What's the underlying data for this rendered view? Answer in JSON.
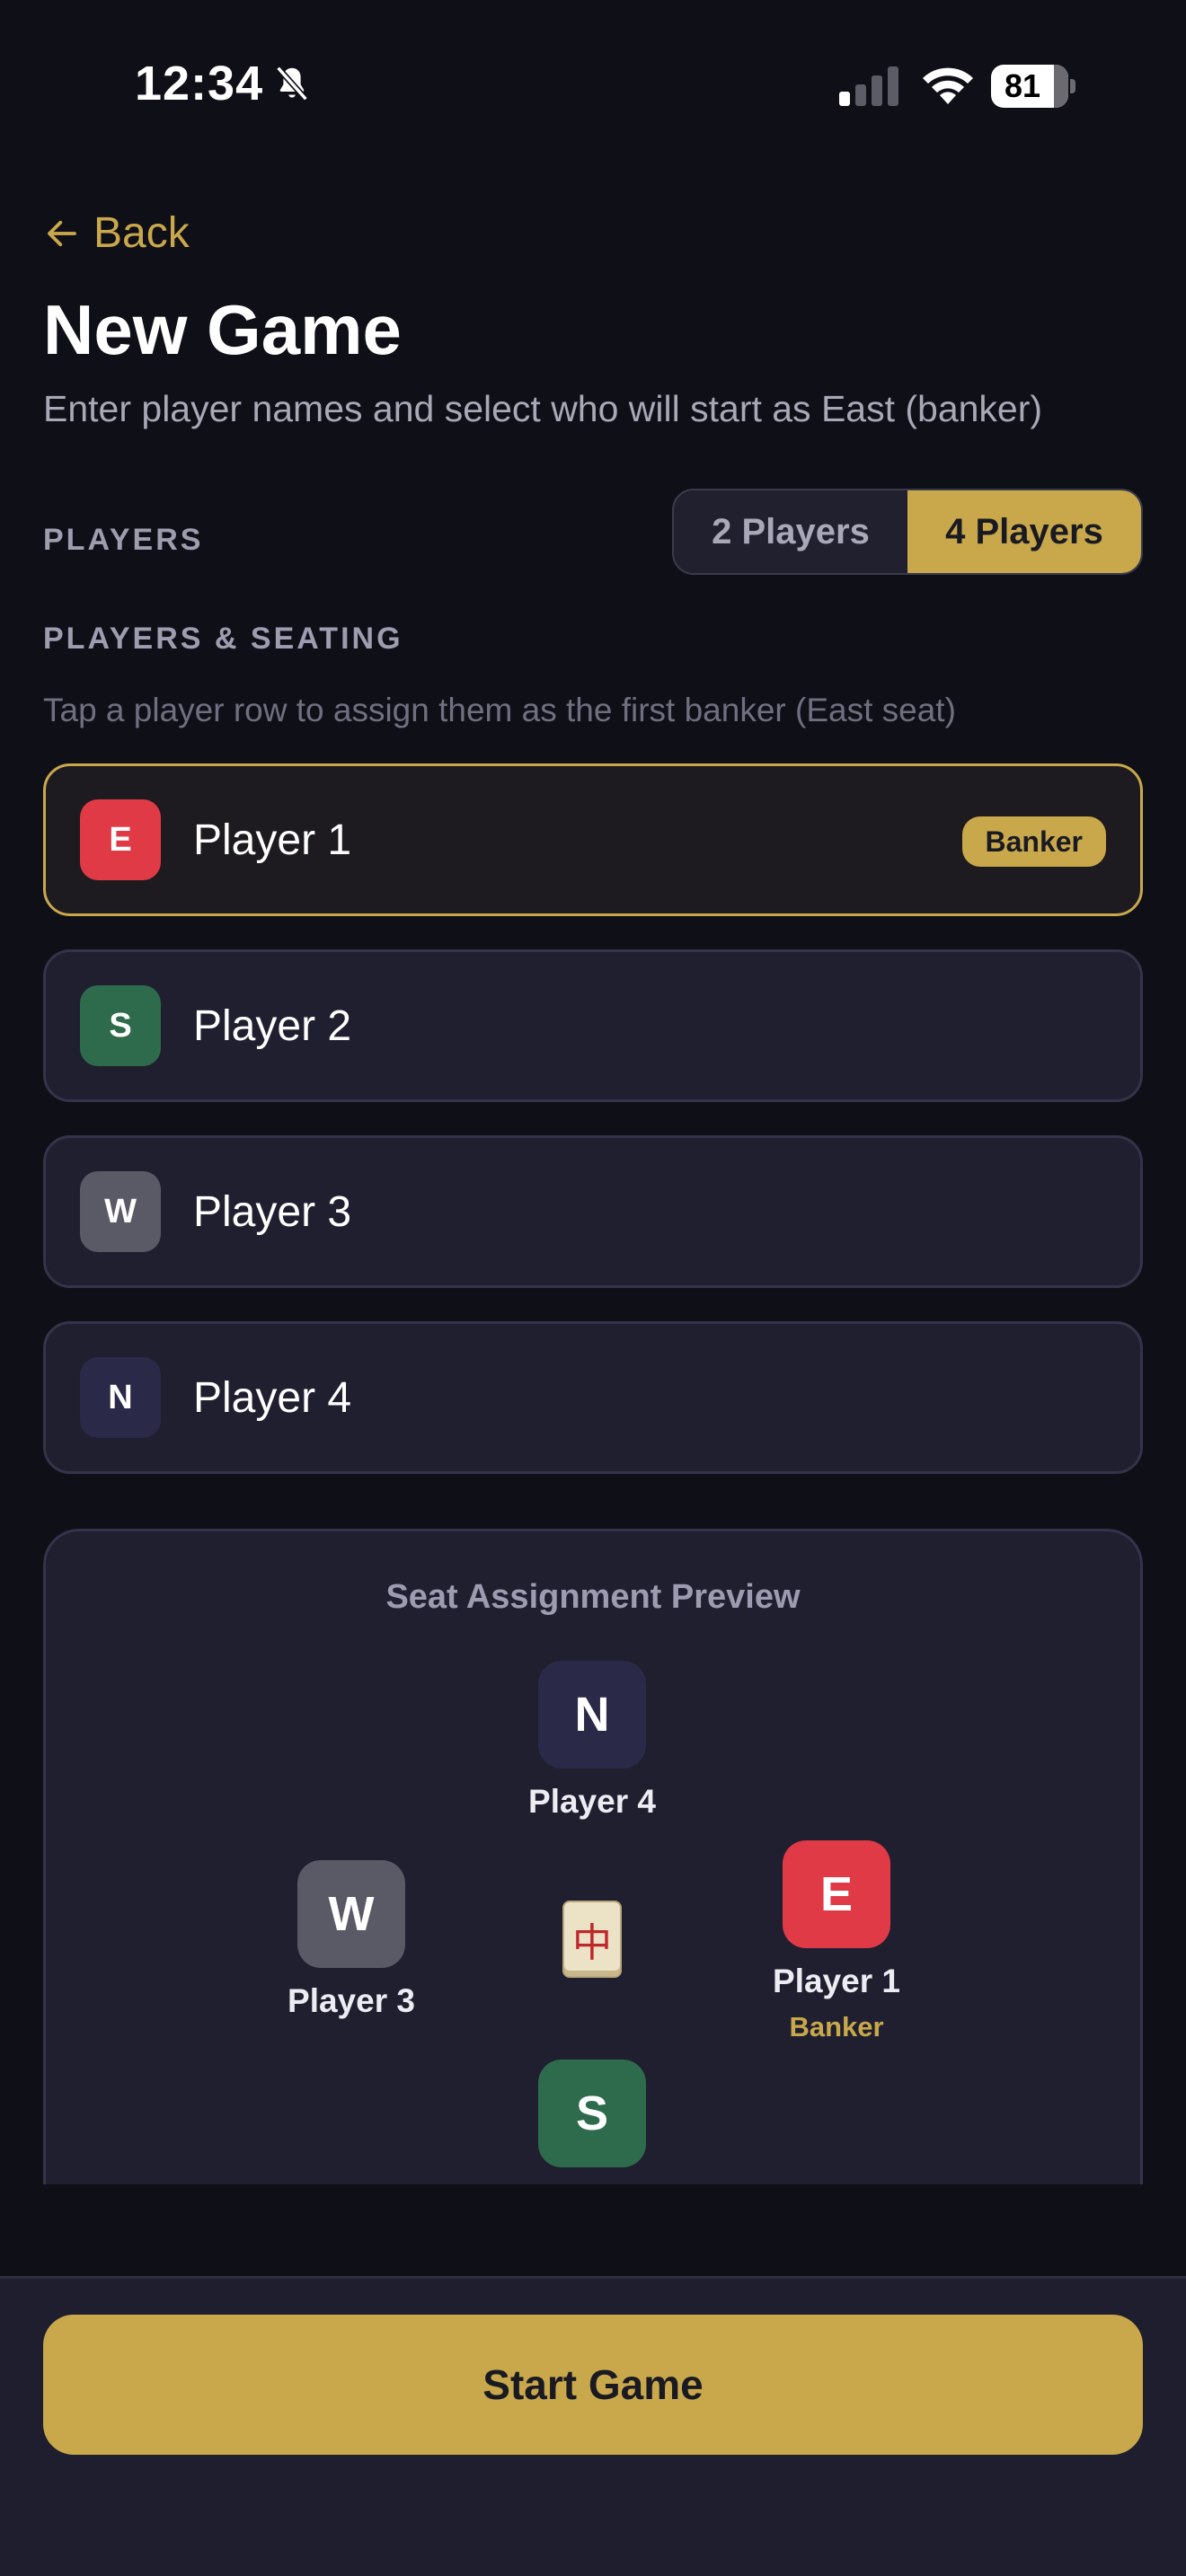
{
  "status_bar": {
    "time": "12:34",
    "battery": "81",
    "icons": [
      "bell-slash-icon",
      "signal-icon",
      "wifi-icon",
      "battery-icon"
    ]
  },
  "header": {
    "back_label": "Back",
    "title": "New Game",
    "subtitle": "Enter player names and select who will start as East (banker)"
  },
  "players_section": {
    "label": "PLAYERS",
    "options": [
      {
        "label": "2 Players",
        "selected": false
      },
      {
        "label": "4 Players",
        "selected": true
      }
    ]
  },
  "seating_section": {
    "label": "PLAYERS & SEATING",
    "hint": "Tap a player row to assign them as the first banker (East seat)"
  },
  "players": [
    {
      "wind": "E",
      "name": "Player 1",
      "banker": true,
      "badge": "Banker",
      "color": "#e03a47"
    },
    {
      "wind": "S",
      "name": "Player 2",
      "banker": false,
      "color": "#2e6b4c"
    },
    {
      "wind": "W",
      "name": "Player 3",
      "banker": false,
      "color": "#5a5a66"
    },
    {
      "wind": "N",
      "name": "Player 4",
      "banker": false,
      "color": "#2a2a48"
    }
  ],
  "preview": {
    "title": "Seat Assignment Preview",
    "center_tile": "中",
    "seats": {
      "north": {
        "wind": "N",
        "name": "Player 4"
      },
      "west": {
        "wind": "W",
        "name": "Player 3"
      },
      "east": {
        "wind": "E",
        "name": "Player 1",
        "banker_label": "Banker"
      },
      "south": {
        "wind": "S"
      }
    }
  },
  "footer": {
    "start_label": "Start Game"
  },
  "colors": {
    "accent": "#c9a84c",
    "background": "#0f0f18",
    "card": "#1f1f30"
  }
}
